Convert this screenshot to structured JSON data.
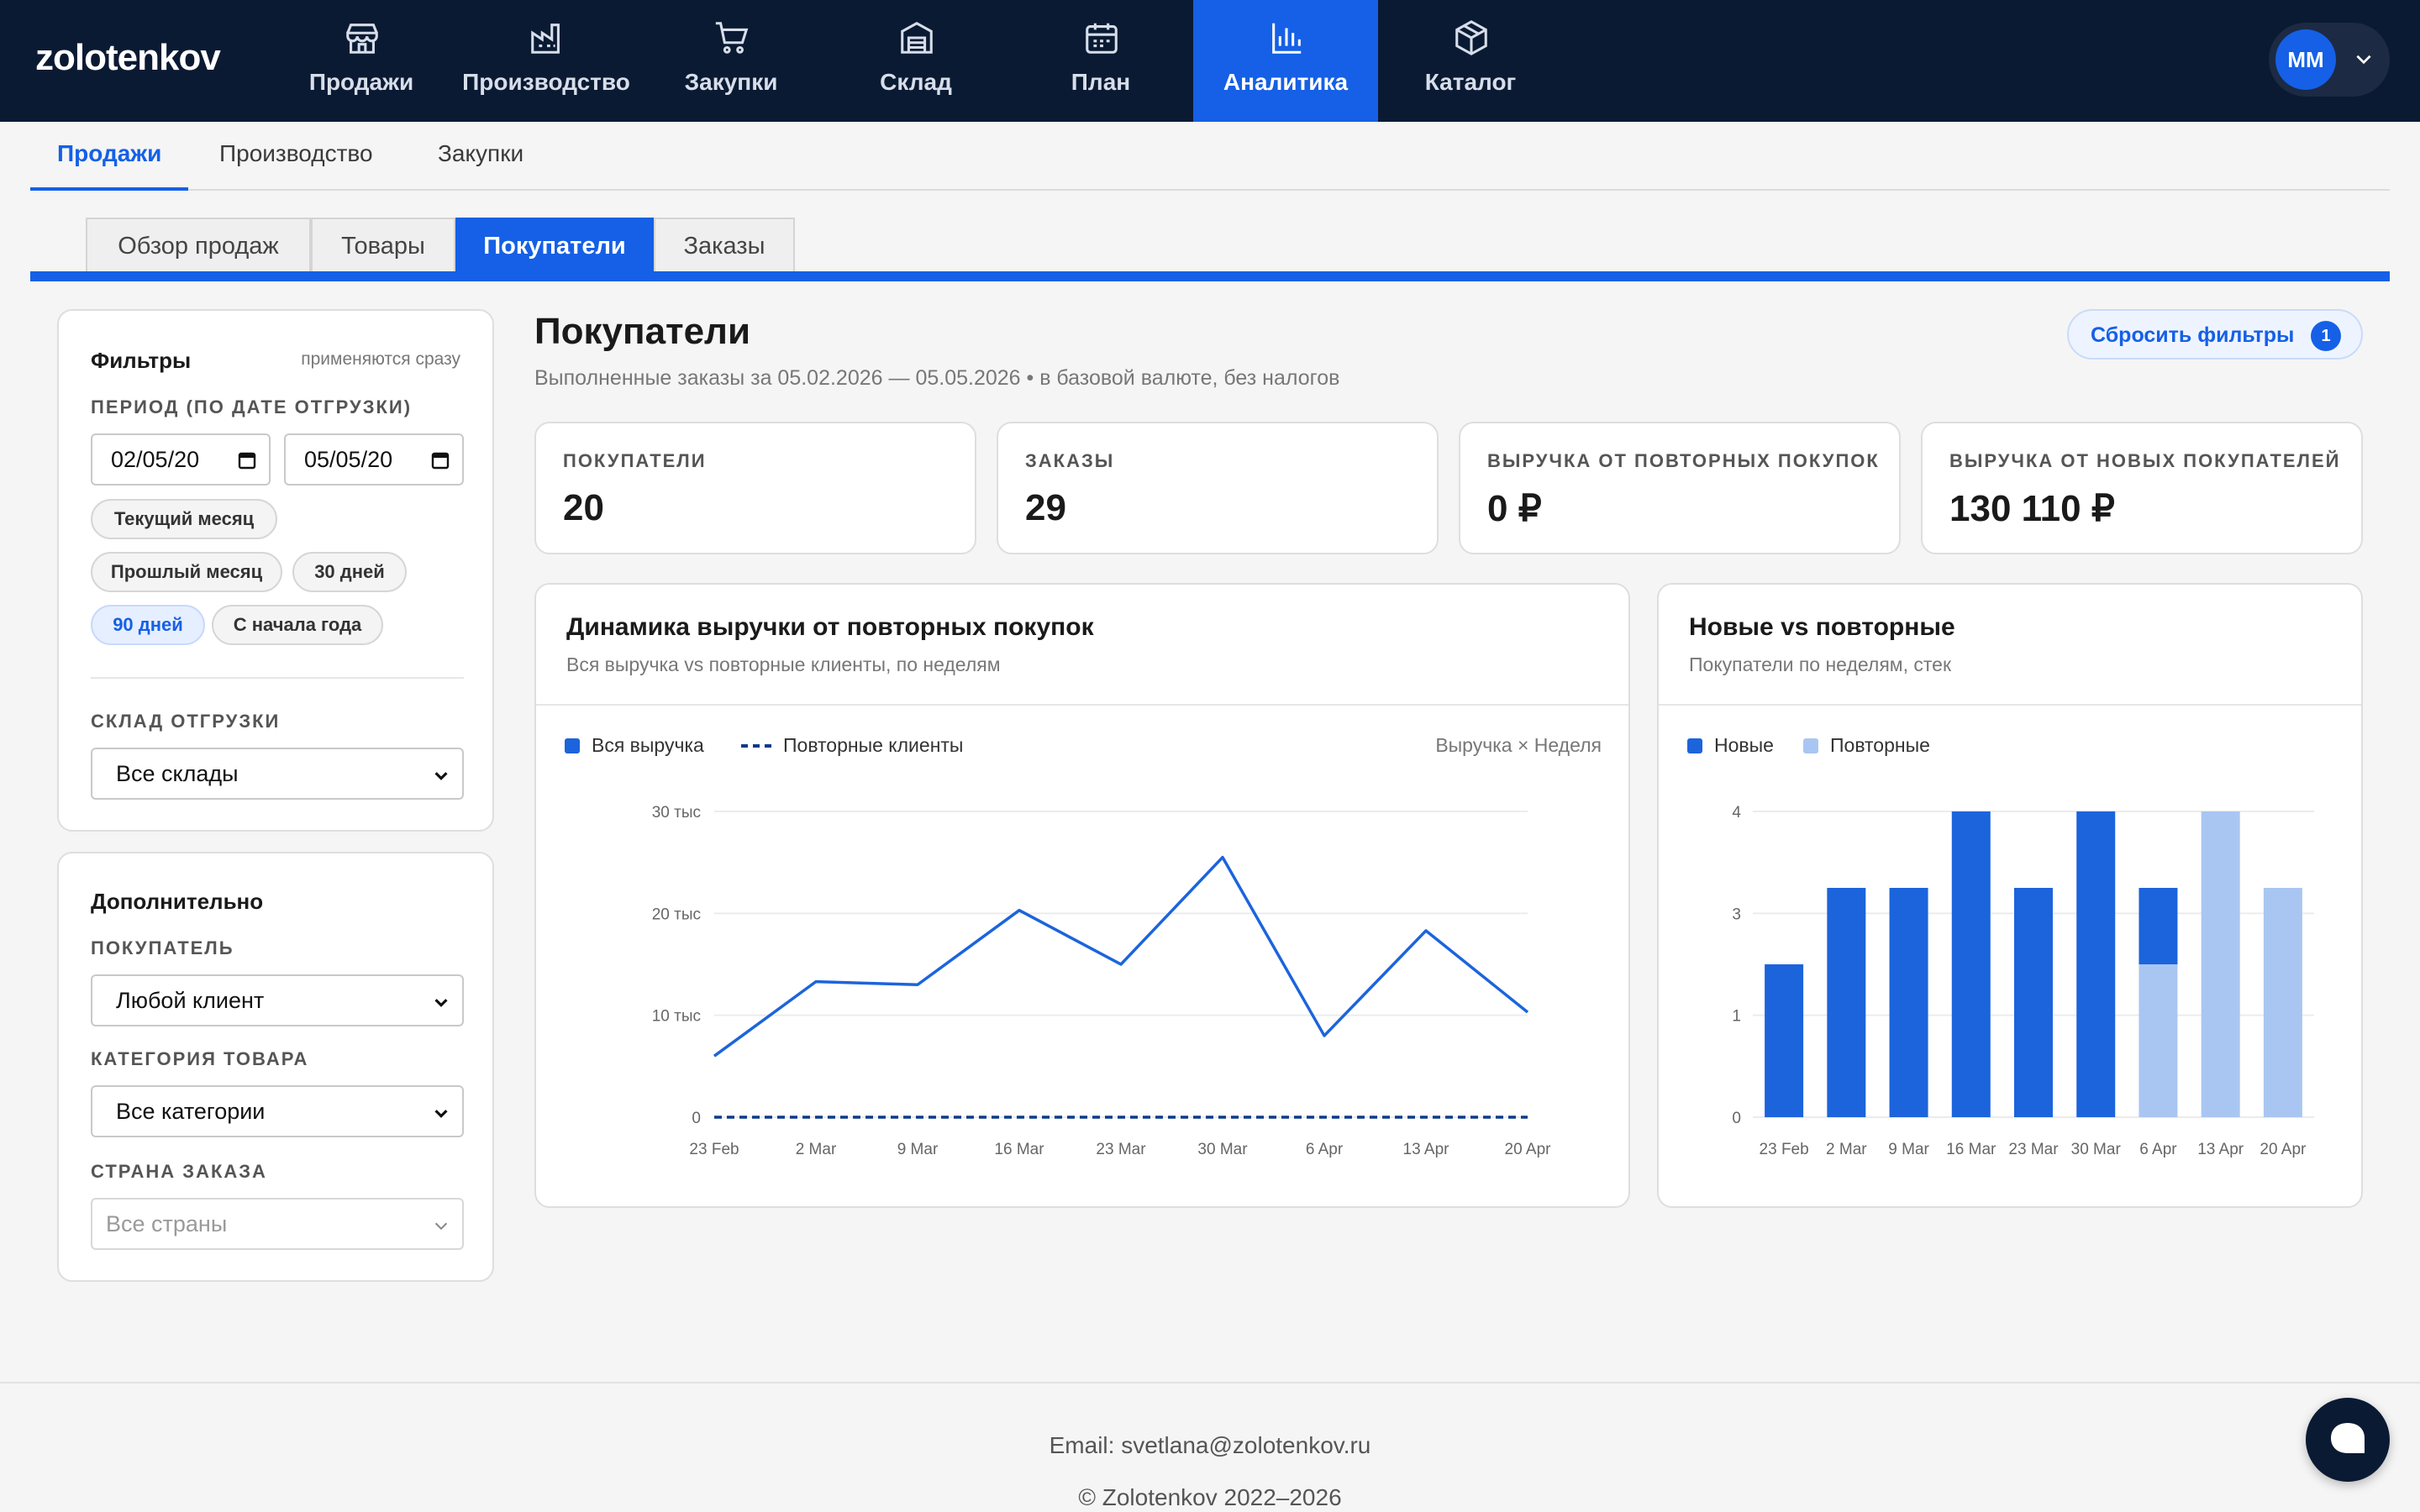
{
  "brand": "zolotenkov",
  "nav": [
    {
      "label": "Продажи",
      "icon": "store-icon"
    },
    {
      "label": "Производство",
      "icon": "factory-icon"
    },
    {
      "label": "Закупки",
      "icon": "cart-icon"
    },
    {
      "label": "Склад",
      "icon": "warehouse-icon"
    },
    {
      "label": "План",
      "icon": "calendar-icon"
    },
    {
      "label": "Аналитика",
      "icon": "bar-chart-icon",
      "active": true
    },
    {
      "label": "Каталог",
      "icon": "box-icon"
    }
  ],
  "user": {
    "initials": "MM"
  },
  "subnav": [
    {
      "label": "Продажи",
      "active": true
    },
    {
      "label": "Производство"
    },
    {
      "label": "Закупки"
    }
  ],
  "tabs": [
    {
      "label": "Обзор продаж"
    },
    {
      "label": "Товары"
    },
    {
      "label": "Покупатели",
      "active": true
    },
    {
      "label": "Заказы"
    }
  ],
  "filters": {
    "title": "Фильтры",
    "hint": "применяются сразу",
    "period_label": "ПЕРИОД (ПО ДАТЕ ОТГРУЗКИ)",
    "date_from": "02/05/20",
    "date_to": "05/05/20",
    "presets": [
      "Текущий месяц",
      "Прошлый месяц",
      "30 дней",
      "90 дней",
      "С начала года"
    ],
    "active_preset": "90 дней",
    "warehouse_label": "СКЛАД ОТГРУЗКИ",
    "warehouse_value": "Все склады"
  },
  "extra": {
    "title": "Дополнительно",
    "customer_label": "ПОКУПАТЕЛЬ",
    "customer_value": "Любой клиент",
    "category_label": "КАТЕГОРИЯ ТОВАРА",
    "category_value": "Все категории",
    "country_label": "СТРАНА ЗАКАЗА",
    "country_placeholder": "Все страны"
  },
  "page": {
    "title": "Покупатели",
    "subtitle": "Выполненные заказы за 05.02.2026 — 05.05.2026 • в базовой валюте, без налогов",
    "reset_label": "Сбросить фильтры",
    "reset_count": "1"
  },
  "kpis": [
    {
      "label": "ПОКУПАТЕЛИ",
      "value": "20"
    },
    {
      "label": "ЗАКАЗЫ",
      "value": "29"
    },
    {
      "label": "ВЫРУЧКА ОТ ПОВТОРНЫХ ПОКУПОК",
      "value": "0 ₽"
    },
    {
      "label": "ВЫРУЧКА ОТ НОВЫХ ПОКУПАТЕЛЕЙ",
      "value": "130 110 ₽"
    }
  ],
  "colors": {
    "accent": "#1560e6",
    "nav_bg": "#0b1a33",
    "series_new": "#1c64dc",
    "series_repeat": "#a9c6f2",
    "dashed": "#0b3a8a"
  },
  "chart_data": [
    {
      "type": "line",
      "title": "Динамика выручки от повторных покупок",
      "subtitle": "Вся выручка vs повторные клиенты, по неделям",
      "axis_hint": "Выручка × Неделя",
      "x": [
        "23 Feb",
        "2 Mar",
        "9 Mar",
        "16 Mar",
        "23 Mar",
        "30 Mar",
        "6 Apr",
        "13 Apr",
        "20 Apr"
      ],
      "yticks": [
        {
          "v": 0,
          "t": "0"
        },
        {
          "v": 10000,
          "t": "10 тыс"
        },
        {
          "v": 20000,
          "t": "20 тыс"
        },
        {
          "v": 30000,
          "t": "30 тыс"
        }
      ],
      "ylim": [
        0,
        30000
      ],
      "grid": true,
      "legend": "top-left",
      "series": [
        {
          "name": "Вся выручка",
          "values": [
            6000,
            13300,
            13000,
            20300,
            15000,
            25500,
            8000,
            18300,
            10300
          ]
        },
        {
          "name": "Повторные клиенты",
          "values": [
            0,
            0,
            0,
            0,
            0,
            0,
            0,
            0,
            0
          ]
        }
      ]
    },
    {
      "type": "bar",
      "stacked": true,
      "title": "Новые vs повторные",
      "subtitle": "Покупатели по неделям, стек",
      "categories": [
        "23 Feb",
        "2 Mar",
        "9 Mar",
        "16 Mar",
        "23 Mar",
        "30 Mar",
        "6 Apr",
        "13 Apr",
        "20 Apr"
      ],
      "yticks": [
        {
          "v": 0,
          "t": "0"
        },
        {
          "v": 1,
          "t": "1"
        },
        {
          "v": 2,
          "t": "3"
        },
        {
          "v": 3,
          "t": "4"
        }
      ],
      "ylim": [
        0,
        3
      ],
      "grid": true,
      "legend": "top-left",
      "series": [
        {
          "name": "Новые",
          "values": [
            1.5,
            2.25,
            2.25,
            3,
            2.25,
            3,
            0.75,
            0,
            0
          ]
        },
        {
          "name": "Повторные",
          "values": [
            0,
            0,
            0,
            0,
            0,
            0,
            1.5,
            3,
            2.25
          ]
        }
      ]
    }
  ],
  "footer": {
    "email": "Email: svetlana@zolotenkov.ru",
    "copyright": "© Zolotenkov 2022–2026"
  }
}
